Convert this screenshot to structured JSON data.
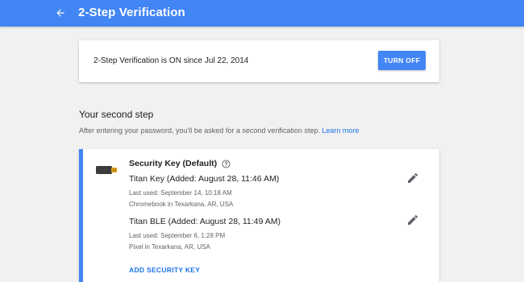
{
  "header": {
    "title": "2-Step Verification",
    "back_icon": "arrow-back-icon",
    "color": "#4285f4"
  },
  "status": {
    "text": "2-Step Verification is ON since Jul 22, 2014",
    "turn_off_label": "TURN OFF"
  },
  "second_step": {
    "title": "Your second step",
    "description": "After entering your password, you'll be asked for a second verification step.",
    "learn_more": "Learn more"
  },
  "security_key": {
    "header": "Security Key (Default)",
    "icon": "usb-key-icon",
    "keys": [
      {
        "name": "Titan Key (Added: August 28, 11:46 AM)",
        "last_used": "Last used: September 14, 10:18 AM",
        "location": "Chromebook in Texarkana, AR, USA"
      },
      {
        "name": "Titan BLE (Added: August 28, 11:49 AM)",
        "last_used": "Last used: September 6, 1:28 PM",
        "location": "Pixel in Texarkana, AR, USA"
      }
    ],
    "add_label": "ADD SECURITY KEY"
  },
  "colors": {
    "accent": "#4285f4",
    "link": "#1a73e8",
    "background": "#f1f1f1"
  }
}
